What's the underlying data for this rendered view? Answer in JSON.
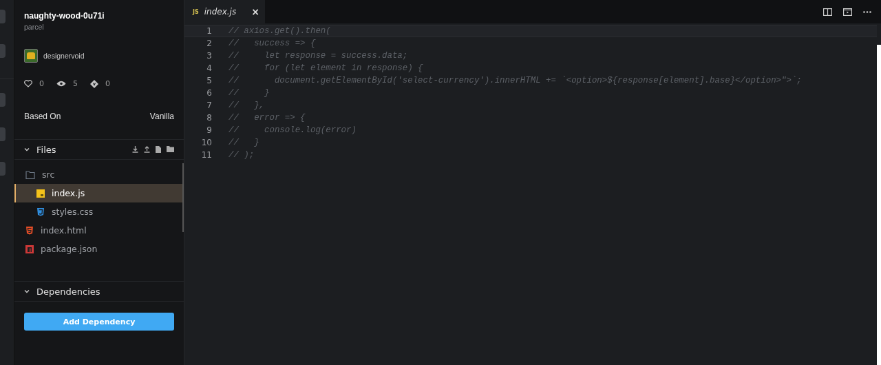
{
  "project": {
    "name": "naughty-wood-0u71i",
    "template": "parcel",
    "author": "designervoid",
    "stats": [
      {
        "kind": "likes",
        "value": "0"
      },
      {
        "kind": "views",
        "value": "5"
      },
      {
        "kind": "forks",
        "value": "0"
      }
    ],
    "based_on": {
      "label": "Based On",
      "value": "Vanilla"
    }
  },
  "files": {
    "title": "Files",
    "expanded": true,
    "items": [
      {
        "name": "src",
        "kind": "folder",
        "selected": false,
        "children": [
          {
            "name": "index.js",
            "kind": "js",
            "selected": true
          },
          {
            "name": "styles.css",
            "kind": "css",
            "selected": false
          }
        ]
      },
      {
        "name": "index.html",
        "kind": "html",
        "selected": false
      },
      {
        "name": "package.json",
        "kind": "npm",
        "selected": false
      }
    ]
  },
  "dependencies": {
    "title": "Dependencies",
    "expanded": true,
    "button": "Add Dependency"
  },
  "editor": {
    "tabs": [
      {
        "icon": "JS",
        "label": "index.js",
        "selected": true,
        "close": "×"
      }
    ],
    "lines": [
      {
        "number": "1",
        "text": "// axios.get().then("
      },
      {
        "number": "2",
        "text": "//   success => {"
      },
      {
        "number": "3",
        "text": "//     let response = success.data;"
      },
      {
        "number": "4",
        "text": "//     for (let element in response) {"
      },
      {
        "number": "5",
        "text": "//       document.getElementById('select-currency').innerHTML += `<option>${response[element].base}</option>\">`;"
      },
      {
        "number": "6",
        "text": "//     }"
      },
      {
        "number": "7",
        "text": "//   },"
      },
      {
        "number": "8",
        "text": "//   error => {"
      },
      {
        "number": "9",
        "text": "//     console.log(error)"
      },
      {
        "number": "10",
        "text": "//   }"
      },
      {
        "number": "11",
        "text": "// );"
      }
    ]
  }
}
